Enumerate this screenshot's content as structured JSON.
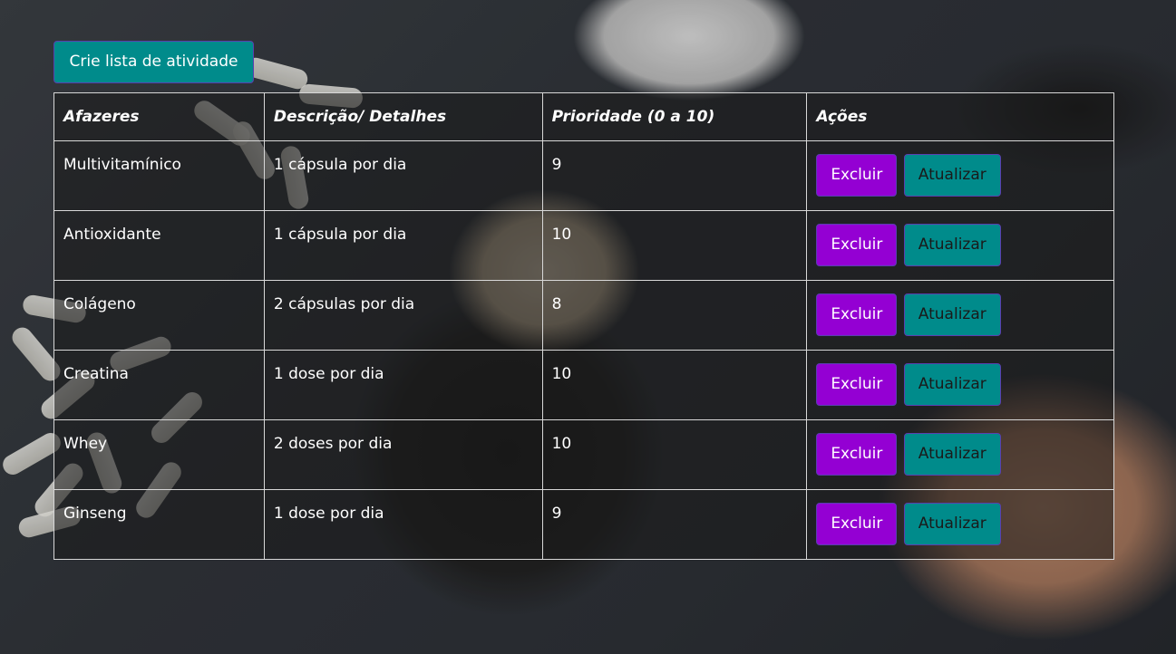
{
  "header": {
    "create_button_label": "Crie lista de atividade"
  },
  "table": {
    "columns": [
      "Afazeres",
      "Descrição/ Detalhes",
      "Prioridade (0 a 10)",
      "Ações"
    ],
    "rows": [
      {
        "task": "Multivitamínico",
        "details": "1 cápsula por dia",
        "priority": "9"
      },
      {
        "task": "Antioxidante",
        "details": "1 cápsula por dia",
        "priority": "10"
      },
      {
        "task": "Colágeno",
        "details": "2 cápsulas por dia",
        "priority": "8"
      },
      {
        "task": "Creatina",
        "details": "1 dose por dia",
        "priority": "10"
      },
      {
        "task": "Whey",
        "details": "2 doses por dia",
        "priority": "10"
      },
      {
        "task": "Ginseng",
        "details": "1 dose por dia",
        "priority": "9"
      }
    ],
    "actions": {
      "delete_label": "Excluir",
      "update_label": "Atualizar"
    }
  },
  "colors": {
    "create_button_bg": "#008b8b",
    "delete_button_bg": "#9400d3",
    "update_button_bg": "#008b8b",
    "table_border": "#d8d8d8"
  }
}
